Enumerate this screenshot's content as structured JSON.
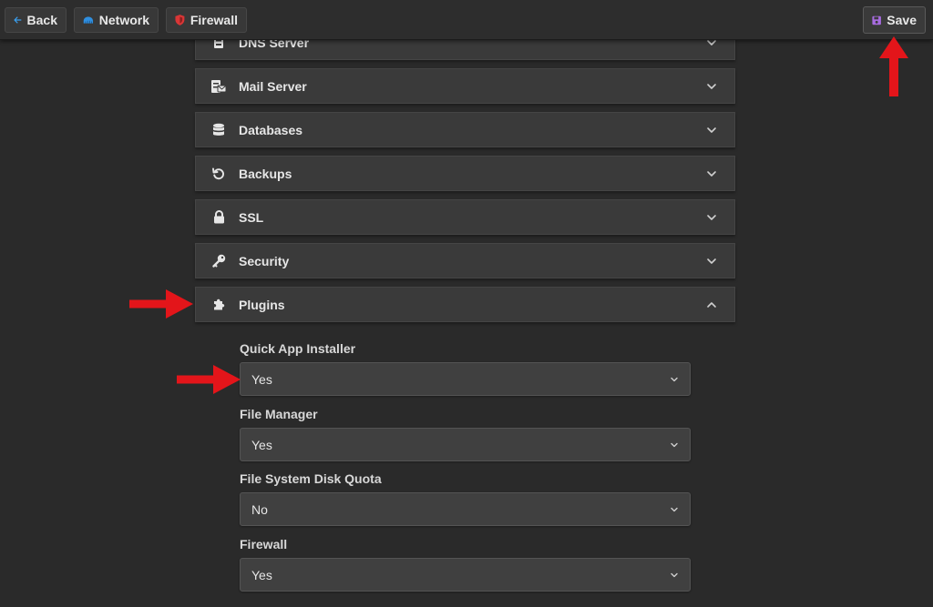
{
  "toolbar": {
    "back_label": "Back",
    "network_label": "Network",
    "firewall_label": "Firewall",
    "save_label": "Save"
  },
  "accordion": {
    "items": [
      {
        "title": "DNS Server",
        "icon": "dns-server-icon",
        "expanded": false
      },
      {
        "title": "Mail Server",
        "icon": "mail-server-icon",
        "expanded": false
      },
      {
        "title": "Databases",
        "icon": "database-icon",
        "expanded": false
      },
      {
        "title": "Backups",
        "icon": "backup-icon",
        "expanded": false
      },
      {
        "title": "SSL",
        "icon": "lock-icon",
        "expanded": false
      },
      {
        "title": "Security",
        "icon": "key-icon",
        "expanded": false
      },
      {
        "title": "Plugins",
        "icon": "puzzle-icon",
        "expanded": true
      }
    ]
  },
  "plugins": {
    "fields": [
      {
        "label": "Quick App Installer",
        "value": "Yes"
      },
      {
        "label": "File Manager",
        "value": "Yes"
      },
      {
        "label": "File System Disk Quota",
        "value": "No"
      },
      {
        "label": "Firewall",
        "value": "Yes"
      }
    ]
  },
  "colors": {
    "background": "#2a2a2a",
    "panel": "#3a3a3a",
    "network_icon": "#2f8fe0",
    "firewall_icon": "#d93636",
    "save_icon": "#a86ce0",
    "annotation_arrow": "#e3151a"
  }
}
